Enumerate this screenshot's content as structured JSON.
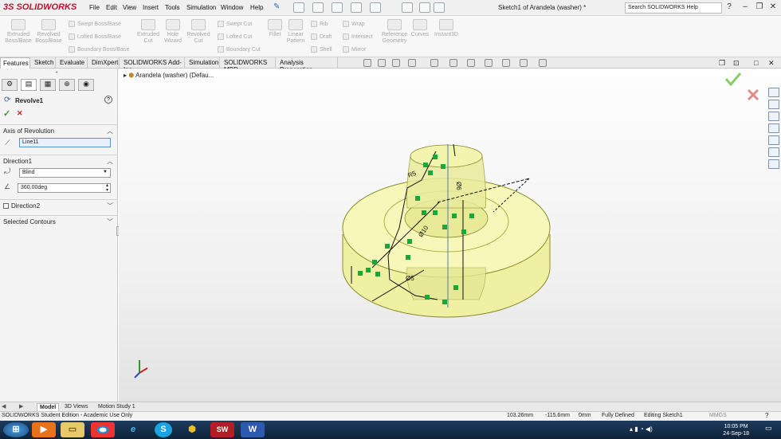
{
  "app": {
    "brand_prefix": "3S",
    "brand": "SOLIDWORKS",
    "doc_title": "Sketch1 of Arandela (washer) *",
    "search_placeholder": "Search SOLIDWORKS Help"
  },
  "menu": [
    "File",
    "Edit",
    "View",
    "Insert",
    "Tools",
    "Simulation",
    "Window",
    "Help"
  ],
  "ribbon": {
    "big": [
      {
        "label": "Extruded\nBoss/Base"
      },
      {
        "label": "Revolved\nBoss/Base"
      },
      {
        "label": "Extruded\nCut"
      },
      {
        "label": "Hole\nWizard"
      },
      {
        "label": "Revolved\nCut"
      },
      {
        "label": "Fillet"
      },
      {
        "label": "Linear\nPattern"
      },
      {
        "label": "Reference\nGeometry"
      },
      {
        "label": "Curves"
      },
      {
        "label": "Instant3D"
      }
    ],
    "small": [
      "Swept Boss/Base",
      "Lofted Boss/Base",
      "Boundary Boss/Base",
      "Swept Cut",
      "Lofted Cut",
      "Boundary Cut",
      "Rib",
      "Draft",
      "Shell",
      "Wrap",
      "Intersect",
      "Mirror"
    ]
  },
  "tabs": [
    "Features",
    "Sketch",
    "Evaluate",
    "DimXpert",
    "SOLIDWORKS Add-Ins",
    "Simulation",
    "SOLIDWORKS MBD",
    "Analysis Preparation"
  ],
  "panel": {
    "feature_title": "Revolve1",
    "help": "?",
    "axis_header": "Axis of Revolution",
    "axis_value": "Line11",
    "direction1_header": "Direction1",
    "end_condition": "Blind",
    "angle": "360.00deg",
    "direction2_label": "Direction2",
    "contours_header": "Selected Contours"
  },
  "tree": {
    "item": "Arandela (washer)  (Defau..."
  },
  "model_tabs": [
    "Model",
    "3D Views",
    "Motion Study 1"
  ],
  "status": {
    "edition": "SOLIDWORKS Student Edition - Academic Use Only",
    "x": "103.26mm",
    "y": "-115.6mm",
    "z": "0mm",
    "defined": "Fully Defined",
    "editing": "Editing Sketch1",
    "units": "MMGS"
  },
  "taskbar": {
    "time": "10:05 PM",
    "date": "24-Sep-18"
  },
  "colors": {
    "brand": "#c8102e",
    "part_fill": "#f6f7a8",
    "part_edge": "#9a9a30",
    "sketch_green": "#14a93a",
    "accept": "#6bbf3a",
    "cancel": "#d23c3c"
  }
}
